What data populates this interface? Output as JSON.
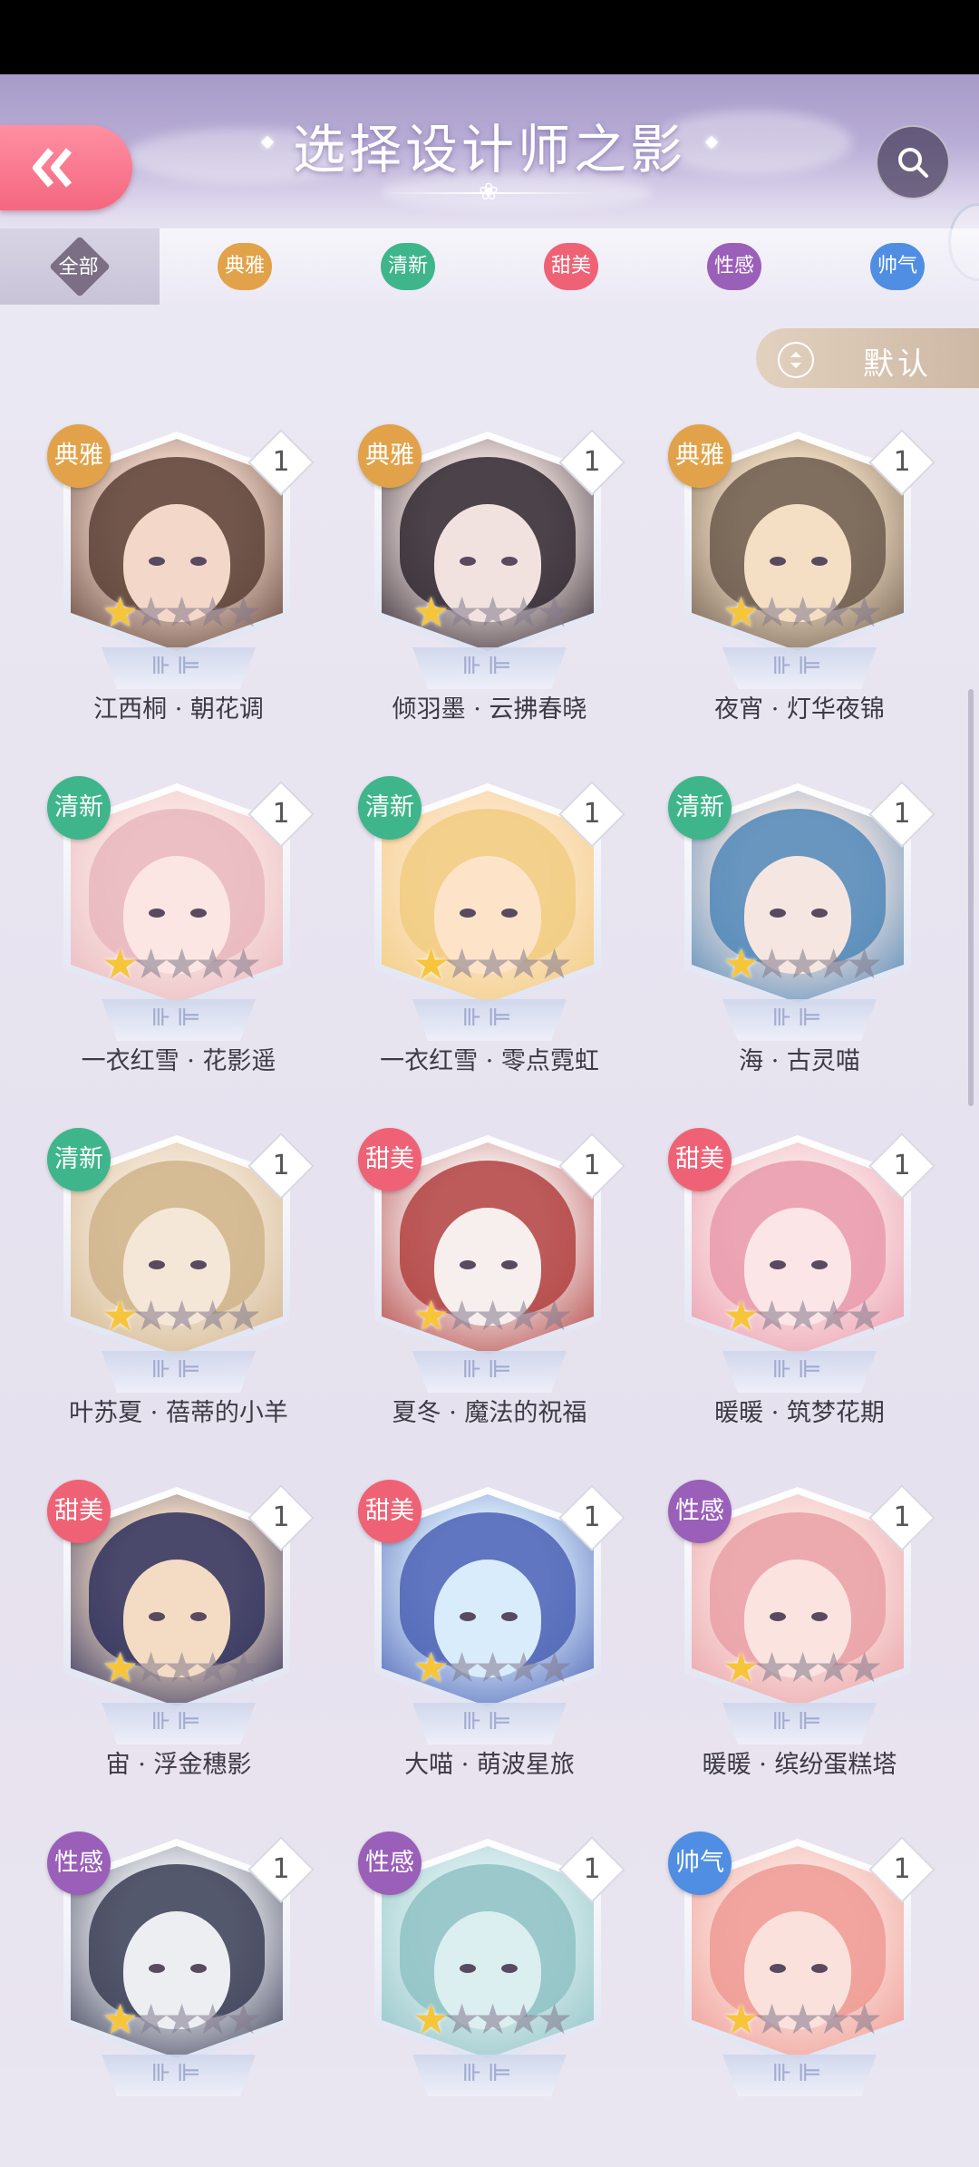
{
  "header": {
    "title": "选择设计师之影",
    "back_icon": "double-chevron-left-icon",
    "search_icon": "search-icon"
  },
  "tabs": [
    {
      "label": "全部",
      "color": "#7b6f86",
      "active": true
    },
    {
      "label": "典雅",
      "color": "#e2a24a",
      "active": false
    },
    {
      "label": "清新",
      "color": "#3fb58c",
      "active": false
    },
    {
      "label": "甜美",
      "color": "#ef6275",
      "active": false
    },
    {
      "label": "性感",
      "color": "#9a5fb8",
      "active": false
    },
    {
      "label": "帅气",
      "color": "#4f8ee3",
      "active": false
    }
  ],
  "sort": {
    "label": "默认"
  },
  "cards": [
    {
      "tag": "典雅",
      "tag_color": "#e2a24a",
      "level": "1",
      "name": "江西桐 · 朝花调",
      "stars": 1,
      "tone": [
        "#f3d7c9",
        "#5b3f35"
      ]
    },
    {
      "tag": "典雅",
      "tag_color": "#e2a24a",
      "level": "1",
      "name": "倾羽墨 · 云拂春晓",
      "stars": 1,
      "tone": [
        "#f2e2df",
        "#2f2730"
      ]
    },
    {
      "tag": "典雅",
      "tag_color": "#e2a24a",
      "level": "1",
      "name": "夜宵 · 灯华夜锦",
      "stars": 1,
      "tone": [
        "#f4dfc4",
        "#6b5a4c"
      ]
    },
    {
      "tag": "清新",
      "tag_color": "#3fb58c",
      "level": "1",
      "name": "一衣红雪 · 花影遥",
      "stars": 1,
      "tone": [
        "#fbe6e3",
        "#e8b7bd"
      ]
    },
    {
      "tag": "清新",
      "tag_color": "#3fb58c",
      "level": "1",
      "name": "一衣红雪 · 零点霓虹",
      "stars": 1,
      "tone": [
        "#fde4c8",
        "#f1cc80"
      ]
    },
    {
      "tag": "清新",
      "tag_color": "#3fb58c",
      "level": "1",
      "name": "海 · 古灵喵",
      "stars": 1,
      "tone": [
        "#f6e6e1",
        "#4f87b8"
      ]
    },
    {
      "tag": "清新",
      "tag_color": "#3fb58c",
      "level": "1",
      "name": "叶苏夏 · 蓓蒂的小羊",
      "stars": 1,
      "tone": [
        "#f5e7d8",
        "#cfb48a"
      ]
    },
    {
      "tag": "甜美",
      "tag_color": "#ef6275",
      "level": "1",
      "name": "夏冬 · 魔法的祝福",
      "stars": 1,
      "tone": [
        "#f6efee",
        "#b24140"
      ]
    },
    {
      "tag": "甜美",
      "tag_color": "#ef6275",
      "level": "1",
      "name": "暖暖 · 筑梦花期",
      "stars": 1,
      "tone": [
        "#fbe5e6",
        "#e99aac"
      ]
    },
    {
      "tag": "甜美",
      "tag_color": "#ef6275",
      "level": "1",
      "name": "宙 · 浮金穗影",
      "stars": 1,
      "tone": [
        "#f4dcc4",
        "#2d2f5c"
      ]
    },
    {
      "tag": "甜美",
      "tag_color": "#ef6275",
      "level": "1",
      "name": "大喵 · 萌波星旅",
      "stars": 1,
      "tone": [
        "#d9ecfb",
        "#4b62b5"
      ]
    },
    {
      "tag": "性感",
      "tag_color": "#9a5fb8",
      "level": "1",
      "name": "暖暖 · 缤纷蛋糕塔",
      "stars": 1,
      "tone": [
        "#fbe3df",
        "#e9a0a6"
      ]
    },
    {
      "tag": "性感",
      "tag_color": "#9a5fb8",
      "level": "1",
      "name": "",
      "stars": 1,
      "tone": [
        "#eceef2",
        "#3a3d55"
      ]
    },
    {
      "tag": "性感",
      "tag_color": "#9a5fb8",
      "level": "1",
      "name": "",
      "stars": 1,
      "tone": [
        "#dbeef0",
        "#8fc2c4"
      ]
    },
    {
      "tag": "帅气",
      "tag_color": "#4f8ee3",
      "level": "1",
      "name": "",
      "stars": 1,
      "tone": [
        "#fbe1dc",
        "#ef9a93"
      ]
    }
  ]
}
